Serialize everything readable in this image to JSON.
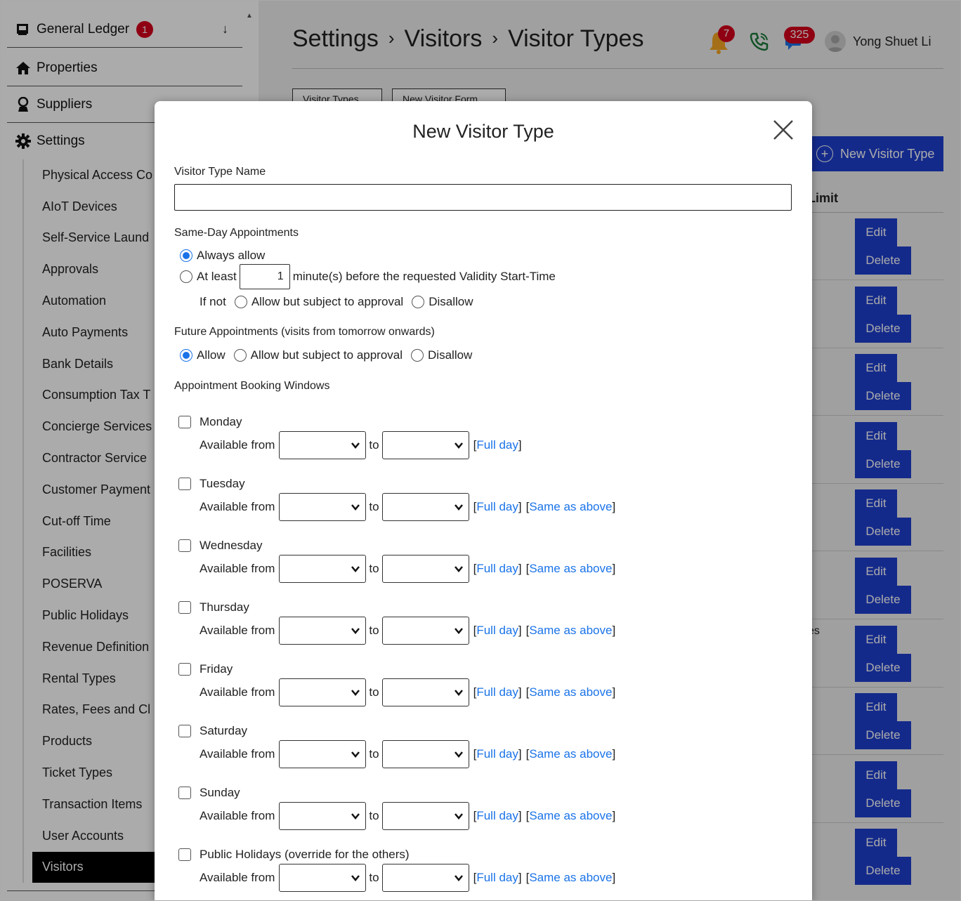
{
  "sidebar": {
    "top_items": [
      {
        "label": "General Ledger",
        "badge": "1",
        "icon": "ledger-icon",
        "arrow": "↓"
      },
      {
        "label": "Properties",
        "icon": "home-icon"
      },
      {
        "label": "Suppliers",
        "icon": "supplier-icon"
      },
      {
        "label": "Settings",
        "icon": "gear-icon"
      }
    ],
    "sub_items": [
      "Physical Access Co",
      "AIoT Devices",
      "Self-Service Laund",
      "Approvals",
      "Automation",
      "Auto Payments",
      "Bank Details",
      "Consumption Tax T",
      "Concierge Services",
      "Contractor Service",
      "Customer Payment",
      "Cut-off Time",
      "Facilities",
      "POSERVA",
      "Public Holidays",
      "Revenue Definition",
      "Rental Types",
      "Rates, Fees and Cl",
      "Products",
      "Ticket Types",
      "Transaction Items",
      "User Accounts",
      "Visitors"
    ],
    "active_item": "Visitors"
  },
  "header": {
    "breadcrumb": [
      "Settings",
      "Visitors",
      "Visitor Types"
    ],
    "separator": "›",
    "notifications_count": "7",
    "messages_count": "325",
    "user_name": "Yong Shuet Li"
  },
  "page": {
    "tabs": [
      "Visitor Types",
      "New Visitor Form"
    ],
    "new_button_label": "New Visitor Type",
    "column_header_fragment": "Limit",
    "row_text_fragment": "es",
    "edit_label": "Edit",
    "delete_label": "Delete"
  },
  "modal": {
    "title": "New Visitor Type",
    "name_label": "Visitor Type Name",
    "name_value": "",
    "same_day": {
      "label": "Same-Day Appointments",
      "always_allow": "Always allow",
      "at_least": "At least",
      "minutes_value": "1",
      "minutes_suffix": "minute(s) before the requested Validity Start-Time",
      "if_not": "If not",
      "allow_subject": "Allow but subject to approval",
      "disallow": "Disallow"
    },
    "future": {
      "label": "Future Appointments (visits from tomorrow onwards)",
      "allow": "Allow",
      "allow_subject": "Allow but subject to approval",
      "disallow": "Disallow"
    },
    "windows": {
      "label": "Appointment Booking Windows",
      "available_from": "Available from",
      "to": "to",
      "full_day": "Full day",
      "same_as_above": "Same as above",
      "days": [
        "Monday",
        "Tuesday",
        "Wednesday",
        "Thursday",
        "Friday",
        "Saturday",
        "Sunday",
        "Public Holidays (override for the others)"
      ]
    }
  }
}
